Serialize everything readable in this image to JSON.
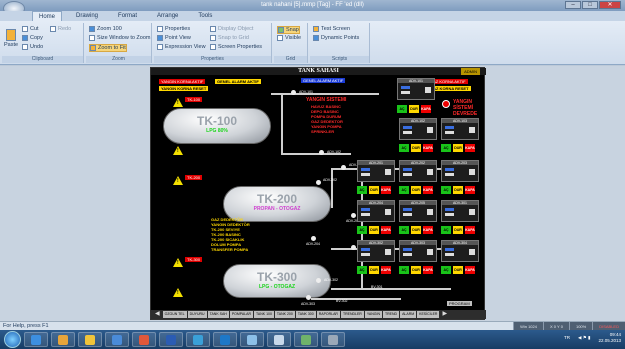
{
  "window": {
    "title": "tank nahani [5].mmp [Tag] - FF 'ed (dll)"
  },
  "window_buttons": [
    "–",
    "□",
    "✕"
  ],
  "ribbon": {
    "tabs": [
      "Home",
      "Drawing",
      "Format",
      "Arrange",
      "Tools"
    ],
    "clipboard": {
      "cut": "Cut",
      "copy": "Copy",
      "paste": "Paste",
      "undo": "Undo",
      "redo": "Redo",
      "caption": "Clipboard"
    },
    "zoom": {
      "zoom100": "Zoom 100",
      "size_window": "Size Window to Zoom",
      "zoom_fit": "Zoom to Fit",
      "caption": "Zoom"
    },
    "properties": {
      "properties": "Properties",
      "point_view": "Point View",
      "expression_view": "Expression View",
      "display_object": "Display Object",
      "snap_to_grid": "Snap to Grid",
      "screen_properties": "Screen Properties",
      "caption": "Properties"
    },
    "grid": {
      "snap": "Snap",
      "visible": "Visible",
      "caption": "Grid"
    },
    "scripts": {
      "test_screen": "Test Screen",
      "dynamic_points": "Dynamic Points",
      "caption": "Scripts"
    }
  },
  "scada": {
    "header": "TANK SAHASI",
    "header_tag": "ADMIN",
    "top_tags": {
      "alarm_left": "YANGIN KORNA AKTIF",
      "reset_left": "YANGIN KORNA RESET",
      "alarm_mid": "GENEL ALARM AKTIF",
      "alarm_right": "GAZ KORNA AKTIF",
      "reset_right": "GAZ KORNA RESET"
    },
    "tanks": [
      {
        "name": "TK-100",
        "product": "LPG 80%",
        "pv_class": ""
      },
      {
        "name": "TK-200",
        "product": "PROPAN - OTOGAZ",
        "pv_class": "m"
      },
      {
        "name": "TK-300",
        "product": "LPG - OTOGAZ",
        "pv_class": ""
      }
    ],
    "red_heading": "YANGIN SISTEMI",
    "red_lines": [
      "HAVUZ BASINC",
      "DEPO BASINC",
      "POMPA DURUM",
      "GAZ DEDEKTOR",
      "YANGIN POMPA",
      "SPRINKLER"
    ],
    "right_red": [
      "YANGIN",
      "SİSTEMİ",
      "DEVREDE"
    ],
    "valves": [
      "ADV-101",
      "ADV-102",
      "ADV-201",
      "ADV-202",
      "ADV-203",
      "ADV-204",
      "ADV-301",
      "ADV-302",
      "ADV-303",
      "BV-301",
      "BV-302",
      "BV-201"
    ],
    "panels": [
      "ADV-101",
      "ADV-102",
      "ADV-103",
      "ADV-201",
      "ADV-202",
      "ADV-203",
      "ADV-204",
      "ADV-205",
      "ADV-301",
      "ADV-302",
      "ADV-303",
      "ADV-304"
    ],
    "buttons": {
      "ac": "AÇ",
      "dur": "DUR",
      "kapa": "KAPA"
    },
    "left_info": [
      "GAZ DEDEKTÖR",
      "YANGIN DEDEKTÖR",
      "TK-200 SEVIYE",
      "TK-200 BASINC",
      "TK-200 SICAKLIK",
      "DOLUM POMPA",
      "TRANSFER POMPA"
    ],
    "nav_items": [
      "OZGUN TEL",
      "DUYURU",
      "TANK SAH",
      "POMPALAR",
      "TANK 100",
      "TANK 200",
      "TANK 300",
      "RAPORLAR",
      "TRENDLER",
      "YANGIN",
      "TREND",
      "ALARM",
      "KESİCİLER"
    ],
    "bottom_right_tag": "PROGRAM"
  },
  "statusbar": {
    "text": "For Help, press F1",
    "fields": [
      "Win 1024",
      "X 0 Y 0",
      "100%",
      "DISABLED"
    ]
  },
  "tray": {
    "lang": "TR",
    "time": "09:44",
    "date": "22.05.2013"
  }
}
